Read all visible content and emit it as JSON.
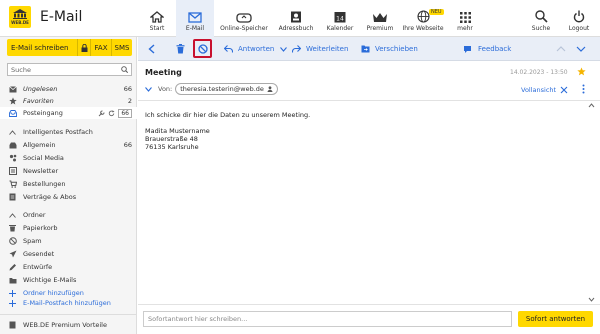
{
  "app": {
    "logo_text": "WEB.DE",
    "title": "E-Mail"
  },
  "nav": [
    {
      "label": "Start",
      "icon": "home-icon"
    },
    {
      "label": "E-Mail",
      "icon": "mail-icon"
    },
    {
      "label": "Online-Speicher",
      "icon": "cloud-icon"
    },
    {
      "label": "Adressbuch",
      "icon": "contacts-icon"
    },
    {
      "label": "Kalender",
      "icon": "calendar-icon",
      "calendar_day": "14"
    },
    {
      "label": "Premium",
      "icon": "crown-icon"
    },
    {
      "label": "Ihre Webseite",
      "icon": "globe-icon",
      "badge": "NEU"
    },
    {
      "label": "mehr",
      "icon": "grid-icon"
    },
    {
      "label": "Suche",
      "icon": "search-icon"
    },
    {
      "label": "Logout",
      "icon": "power-icon"
    }
  ],
  "compose": {
    "label": "E-Mail schreiben",
    "fax": "FAX",
    "sms": "SMS"
  },
  "search": {
    "placeholder": "Suche"
  },
  "folders_top": [
    {
      "label": "Ungelesen",
      "count": "66",
      "icon": "unread-icon"
    },
    {
      "label": "Favoriten",
      "count": "2",
      "icon": "star-icon"
    },
    {
      "label": "Posteingang",
      "count": "66",
      "icon": "inbox-icon"
    }
  ],
  "smart_inbox": {
    "heading": "Intelligentes Postfach",
    "items": [
      {
        "label": "Allgemein",
        "count": "66",
        "icon": "inbox-icon"
      },
      {
        "label": "Social Media",
        "icon": "social-icon"
      },
      {
        "label": "Newsletter",
        "icon": "newsletter-icon"
      },
      {
        "label": "Bestellungen",
        "icon": "cart-icon"
      },
      {
        "label": "Verträge & Abos",
        "icon": "contract-icon"
      }
    ]
  },
  "folders": {
    "heading": "Ordner",
    "items": [
      {
        "label": "Papierkorb",
        "icon": "trash-icon"
      },
      {
        "label": "Spam",
        "icon": "spam-icon"
      },
      {
        "label": "Gesendet",
        "icon": "send-icon"
      },
      {
        "label": "Entwürfe",
        "icon": "pencil-icon"
      },
      {
        "label": "Wichtige E-Mails",
        "icon": "folder-icon"
      }
    ],
    "add_folder": "Ordner hinzufügen",
    "add_mailbox": "E-Mail-Postfach hinzufügen"
  },
  "premium_footer": "WEB.DE Premium Vorteile",
  "toolbar": {
    "reply": "Antworten",
    "forward": "Weiterleiten",
    "move": "Verschieben",
    "feedback": "Feedback"
  },
  "message": {
    "subject": "Meeting",
    "date": "14.02.2023 - 13:50",
    "from_label": "Von:",
    "from_address": "theresia.testerin@web.de",
    "fullview": "Vollansicht",
    "body_line1": "Ich schicke dir hier die Daten zu unserem Meeting.",
    "address_name": "Madita Mustername",
    "address_street": "Brauerstraße 48",
    "address_city": "76135 Karlsruhe"
  },
  "quick_reply": {
    "placeholder": "Sofortantwort hier schreiben...",
    "button": "Sofort antworten"
  },
  "colors": {
    "accent_yellow": "#ffd800",
    "link_blue": "#2b6cd9",
    "highlight_red": "#c8102e"
  }
}
